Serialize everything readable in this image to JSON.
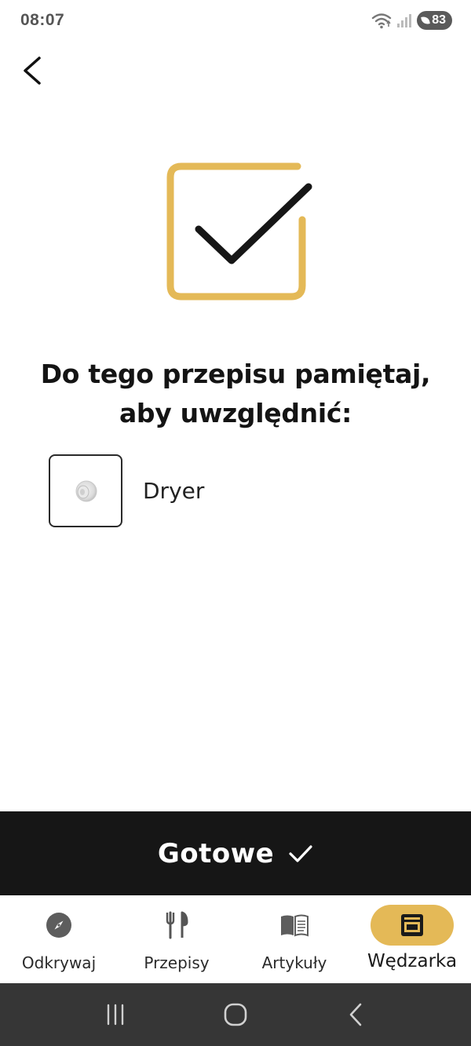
{
  "status_bar": {
    "time": "08:07",
    "battery": "83",
    "icons": [
      "wifi-icon",
      "signal-icon",
      "battery-icon"
    ]
  },
  "header": {
    "back_icon": "chevron-left-icon"
  },
  "hero": {
    "icon": "checkbox-checked-icon",
    "accent_color": "#E4B957"
  },
  "message": {
    "line1": "Do tego przepisu pamiętaj,",
    "line2": "aby uwzględnić:"
  },
  "items": [
    {
      "name": "Dryer",
      "icon": "dryer-puck-icon"
    }
  ],
  "done_button": {
    "label": "Gotowe",
    "icon": "check-icon",
    "background": "#161616"
  },
  "bottom_nav": {
    "items": [
      {
        "label": "Odkrywaj",
        "icon": "compass-icon",
        "active": false
      },
      {
        "label": "Przepisy",
        "icon": "fork-knife-icon",
        "active": false
      },
      {
        "label": "Artykuły",
        "icon": "open-book-icon",
        "active": false
      },
      {
        "label": "Wędzarka",
        "icon": "smoker-oven-icon",
        "active": true
      }
    ],
    "active_color": "#E4B957"
  },
  "system_nav": {
    "buttons": [
      "recent-apps-icon",
      "home-icon",
      "back-icon"
    ]
  }
}
